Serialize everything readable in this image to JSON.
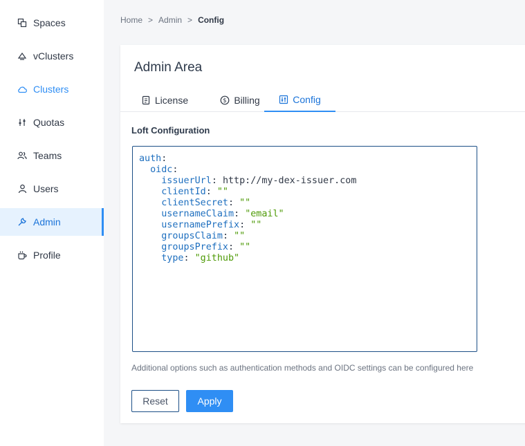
{
  "sidebar": {
    "items": [
      {
        "label": "Spaces",
        "icon": "spaces-icon"
      },
      {
        "label": "vClusters",
        "icon": "vcluster-icon"
      },
      {
        "label": "Clusters",
        "icon": "cloud-icon"
      },
      {
        "label": "Quotas",
        "icon": "sliders-icon"
      },
      {
        "label": "Teams",
        "icon": "team-icon"
      },
      {
        "label": "Users",
        "icon": "user-icon"
      },
      {
        "label": "Admin",
        "icon": "wrench-icon"
      },
      {
        "label": "Profile",
        "icon": "cup-icon"
      }
    ],
    "active": "Admin"
  },
  "breadcrumb": {
    "items": [
      "Home",
      "Admin"
    ],
    "current": "Config",
    "separator": ">"
  },
  "card": {
    "title": "Admin Area",
    "tabs": [
      {
        "label": "License",
        "icon": "document-icon"
      },
      {
        "label": "Billing",
        "icon": "dollar-icon"
      },
      {
        "label": "Config",
        "icon": "config-icon"
      }
    ],
    "active_tab": "Config",
    "section_title": "Loft Configuration",
    "editor": {
      "lines": [
        {
          "key": "auth",
          "sep": ":",
          "value": ""
        },
        {
          "key": "oidc",
          "sep": ":",
          "value": ""
        },
        {
          "key": "issuerUrl",
          "sep": ":",
          "value": "http://my-dex-issuer.com"
        },
        {
          "key": "clientId",
          "sep": ":",
          "value": "\"\""
        },
        {
          "key": "clientSecret",
          "sep": ":",
          "value": "\"\""
        },
        {
          "key": "usernameClaim",
          "sep": ":",
          "value": "\"email\""
        },
        {
          "key": "usernamePrefix",
          "sep": ":",
          "value": "\"\""
        },
        {
          "key": "groupsClaim",
          "sep": ":",
          "value": "\"\""
        },
        {
          "key": "groupsPrefix",
          "sep": ":",
          "value": "\"\""
        },
        {
          "key": "type",
          "sep": ":",
          "value": "\"github\""
        }
      ]
    },
    "help_text": "Additional options such as authentication methods and OIDC settings can be configured here",
    "reset_label": "Reset",
    "apply_label": "Apply"
  },
  "colors": {
    "accent": "#2f8ef4",
    "active_bg": "#e6f2fe",
    "editor_border": "#1b4e86",
    "yaml_key": "#1e6fbf",
    "yaml_string": "#4e9a06"
  }
}
